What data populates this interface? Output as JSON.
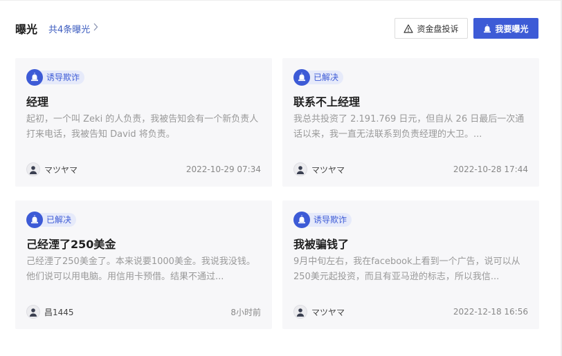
{
  "header": {
    "title": "曝光",
    "count_link": "共4条曝光",
    "complain_button": "资金盘投诉",
    "expose_button": "我要曝光"
  },
  "cards": [
    {
      "tag": "诱导欺诈",
      "title": "经理",
      "desc": "起初，一个叫 Zeki 的人负责，我被告知会有一个新负责人打来电话，我被告知 David 将负责。",
      "author": "マツヤマ",
      "time": "2022-10-29 07:34"
    },
    {
      "tag": "已解决",
      "title": "联系不上经理",
      "desc": "我总共投资了 2.191.769 日元，但自从 26 日最后一次通话以来，我一直无法联系到负责经理的大卫。...",
      "author": "マツヤマ",
      "time": "2022-10-28 17:44"
    },
    {
      "tag": "已解决",
      "title": "己经湮了250美金",
      "desc": "己经湮了250美金了。本来说要1000美金。我说我没钱。他们说可以用电脑。用信用卡预借。结果不通过...",
      "author": "昌1445",
      "time": "8小时前"
    },
    {
      "tag": "诱导欺诈",
      "title": "我被骗钱了",
      "desc": "9月中旬左右，我在facebook上看到一个广告，说可以从250美元起投资，而且有亚马逊的标志，所以我信...",
      "author": "マツヤマ",
      "time": "2022-12-18 16:56"
    }
  ],
  "colors": {
    "accent": "#3d5bd6",
    "tag_bg": "#e6eafa",
    "card_bg": "#f7f7f9"
  },
  "icons": {
    "complain": "warning-triangle-icon",
    "expose": "alarm-siren-icon",
    "tag": "alarm-siren-icon",
    "avatar": "user-silhouette-icon",
    "chevron": "chevron-right-icon"
  }
}
